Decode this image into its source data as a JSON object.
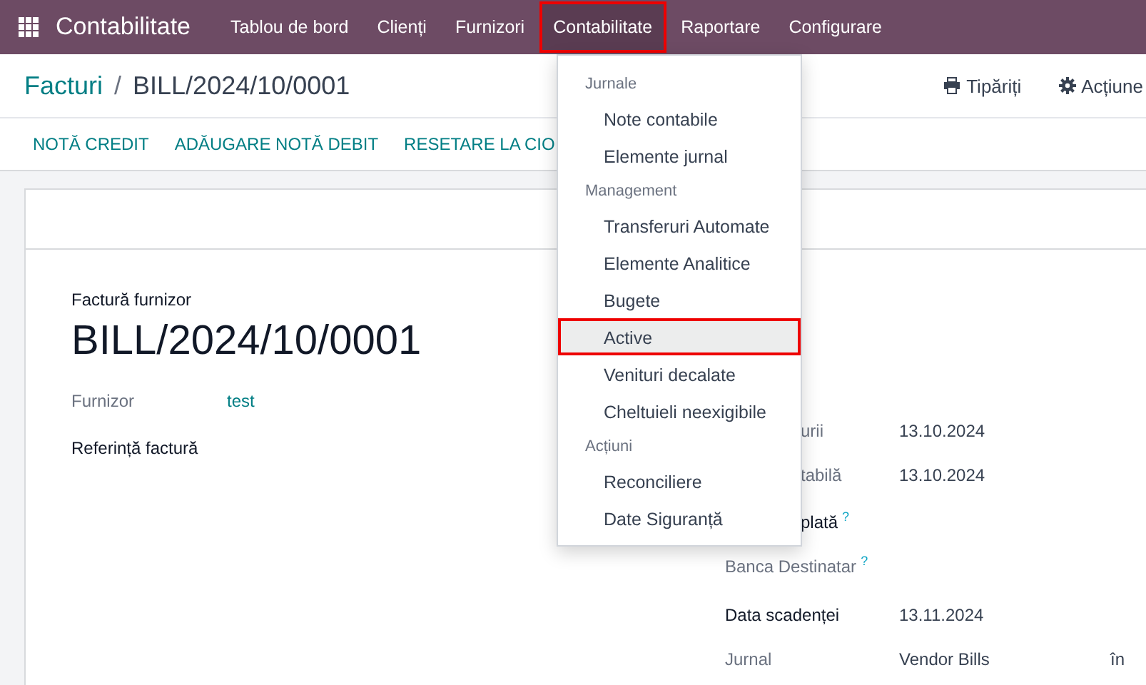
{
  "navbar": {
    "app_title": "Contabilitate",
    "items": [
      {
        "label": "Tablou de bord",
        "selected": false
      },
      {
        "label": "Clienți",
        "selected": false
      },
      {
        "label": "Furnizori",
        "selected": false
      },
      {
        "label": "Contabilitate",
        "selected": true
      },
      {
        "label": "Raportare",
        "selected": false
      },
      {
        "label": "Configurare",
        "selected": false
      }
    ]
  },
  "breadcrumb": {
    "parent": "Facturi",
    "separator": "/",
    "current": "BILL/2024/10/0001"
  },
  "actions": [
    {
      "kind": "print",
      "label": "Tipăriți"
    },
    {
      "kind": "gear",
      "label": "Acțiune"
    }
  ],
  "buttons": [
    "NOTĂ CREDIT",
    "ADĂUGARE NOTĂ DEBIT",
    "RESETARE LA CIO"
  ],
  "form": {
    "subtitle": "Factură furnizor",
    "title": "BILL/2024/10/0001",
    "left_fields": [
      {
        "label": "Furnizor",
        "value": "test",
        "kind": "link"
      },
      {
        "label": "Referință factură",
        "kind": "plain"
      }
    ],
    "right_fields": [
      {
        "label": "urii",
        "value": "13.10.2024",
        "clipped": true,
        "strong": false
      },
      {
        "label": "tabilă",
        "value": "13.10.2024",
        "clipped": true,
        "strong": false
      },
      {
        "label": "plată",
        "clipped": true,
        "strong": true,
        "help": "?"
      },
      {
        "label": "Banca Destinatar",
        "strong": false,
        "help": "?"
      },
      {
        "label": "Data scadenței",
        "value": "13.11.2024",
        "strong": true
      },
      {
        "label": "Jurnal",
        "value": "Vendor Bills",
        "extra": "în",
        "strong": false
      }
    ]
  },
  "dropdown": {
    "sections": [
      {
        "header": "Jurnale",
        "items": [
          {
            "label": "Note contabile",
            "selected": false
          },
          {
            "label": "Elemente jurnal",
            "selected": false
          }
        ]
      },
      {
        "header": "Management",
        "items": [
          {
            "label": "Transferuri Automate",
            "selected": false
          },
          {
            "label": "Elemente Analitice",
            "selected": false
          },
          {
            "label": "Bugete",
            "selected": false
          },
          {
            "label": "Active",
            "selected": true
          },
          {
            "label": "Venituri decalate",
            "selected": false
          },
          {
            "label": "Cheltuieli neexigibile",
            "selected": false
          }
        ]
      },
      {
        "header": "Acțiuni",
        "items": [
          {
            "label": "Reconciliere",
            "selected": false
          },
          {
            "label": "Date Siguranță",
            "selected": false
          }
        ]
      }
    ]
  }
}
